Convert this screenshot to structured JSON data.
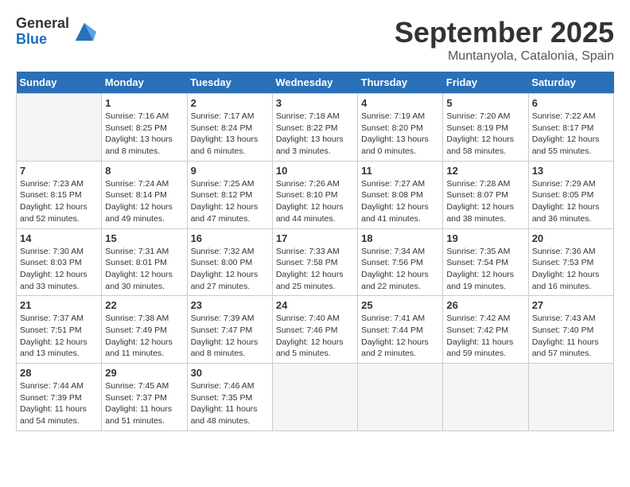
{
  "header": {
    "logo_line1": "General",
    "logo_line2": "Blue",
    "month": "September 2025",
    "location": "Muntanyola, Catalonia, Spain"
  },
  "columns": [
    "Sunday",
    "Monday",
    "Tuesday",
    "Wednesday",
    "Thursday",
    "Friday",
    "Saturday"
  ],
  "weeks": [
    [
      {
        "day": "",
        "info": ""
      },
      {
        "day": "1",
        "info": "Sunrise: 7:16 AM\nSunset: 8:25 PM\nDaylight: 13 hours\nand 8 minutes."
      },
      {
        "day": "2",
        "info": "Sunrise: 7:17 AM\nSunset: 8:24 PM\nDaylight: 13 hours\nand 6 minutes."
      },
      {
        "day": "3",
        "info": "Sunrise: 7:18 AM\nSunset: 8:22 PM\nDaylight: 13 hours\nand 3 minutes."
      },
      {
        "day": "4",
        "info": "Sunrise: 7:19 AM\nSunset: 8:20 PM\nDaylight: 13 hours\nand 0 minutes."
      },
      {
        "day": "5",
        "info": "Sunrise: 7:20 AM\nSunset: 8:19 PM\nDaylight: 12 hours\nand 58 minutes."
      },
      {
        "day": "6",
        "info": "Sunrise: 7:22 AM\nSunset: 8:17 PM\nDaylight: 12 hours\nand 55 minutes."
      }
    ],
    [
      {
        "day": "7",
        "info": "Sunrise: 7:23 AM\nSunset: 8:15 PM\nDaylight: 12 hours\nand 52 minutes."
      },
      {
        "day": "8",
        "info": "Sunrise: 7:24 AM\nSunset: 8:14 PM\nDaylight: 12 hours\nand 49 minutes."
      },
      {
        "day": "9",
        "info": "Sunrise: 7:25 AM\nSunset: 8:12 PM\nDaylight: 12 hours\nand 47 minutes."
      },
      {
        "day": "10",
        "info": "Sunrise: 7:26 AM\nSunset: 8:10 PM\nDaylight: 12 hours\nand 44 minutes."
      },
      {
        "day": "11",
        "info": "Sunrise: 7:27 AM\nSunset: 8:08 PM\nDaylight: 12 hours\nand 41 minutes."
      },
      {
        "day": "12",
        "info": "Sunrise: 7:28 AM\nSunset: 8:07 PM\nDaylight: 12 hours\nand 38 minutes."
      },
      {
        "day": "13",
        "info": "Sunrise: 7:29 AM\nSunset: 8:05 PM\nDaylight: 12 hours\nand 36 minutes."
      }
    ],
    [
      {
        "day": "14",
        "info": "Sunrise: 7:30 AM\nSunset: 8:03 PM\nDaylight: 12 hours\nand 33 minutes."
      },
      {
        "day": "15",
        "info": "Sunrise: 7:31 AM\nSunset: 8:01 PM\nDaylight: 12 hours\nand 30 minutes."
      },
      {
        "day": "16",
        "info": "Sunrise: 7:32 AM\nSunset: 8:00 PM\nDaylight: 12 hours\nand 27 minutes."
      },
      {
        "day": "17",
        "info": "Sunrise: 7:33 AM\nSunset: 7:58 PM\nDaylight: 12 hours\nand 25 minutes."
      },
      {
        "day": "18",
        "info": "Sunrise: 7:34 AM\nSunset: 7:56 PM\nDaylight: 12 hours\nand 22 minutes."
      },
      {
        "day": "19",
        "info": "Sunrise: 7:35 AM\nSunset: 7:54 PM\nDaylight: 12 hours\nand 19 minutes."
      },
      {
        "day": "20",
        "info": "Sunrise: 7:36 AM\nSunset: 7:53 PM\nDaylight: 12 hours\nand 16 minutes."
      }
    ],
    [
      {
        "day": "21",
        "info": "Sunrise: 7:37 AM\nSunset: 7:51 PM\nDaylight: 12 hours\nand 13 minutes."
      },
      {
        "day": "22",
        "info": "Sunrise: 7:38 AM\nSunset: 7:49 PM\nDaylight: 12 hours\nand 11 minutes."
      },
      {
        "day": "23",
        "info": "Sunrise: 7:39 AM\nSunset: 7:47 PM\nDaylight: 12 hours\nand 8 minutes."
      },
      {
        "day": "24",
        "info": "Sunrise: 7:40 AM\nSunset: 7:46 PM\nDaylight: 12 hours\nand 5 minutes."
      },
      {
        "day": "25",
        "info": "Sunrise: 7:41 AM\nSunset: 7:44 PM\nDaylight: 12 hours\nand 2 minutes."
      },
      {
        "day": "26",
        "info": "Sunrise: 7:42 AM\nSunset: 7:42 PM\nDaylight: 11 hours\nand 59 minutes."
      },
      {
        "day": "27",
        "info": "Sunrise: 7:43 AM\nSunset: 7:40 PM\nDaylight: 11 hours\nand 57 minutes."
      }
    ],
    [
      {
        "day": "28",
        "info": "Sunrise: 7:44 AM\nSunset: 7:39 PM\nDaylight: 11 hours\nand 54 minutes."
      },
      {
        "day": "29",
        "info": "Sunrise: 7:45 AM\nSunset: 7:37 PM\nDaylight: 11 hours\nand 51 minutes."
      },
      {
        "day": "30",
        "info": "Sunrise: 7:46 AM\nSunset: 7:35 PM\nDaylight: 11 hours\nand 48 minutes."
      },
      {
        "day": "",
        "info": ""
      },
      {
        "day": "",
        "info": ""
      },
      {
        "day": "",
        "info": ""
      },
      {
        "day": "",
        "info": ""
      }
    ]
  ]
}
